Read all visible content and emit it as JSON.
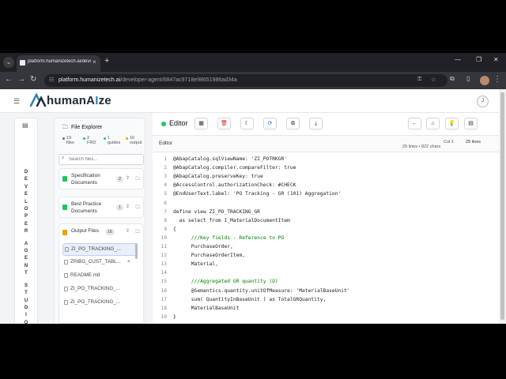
{
  "browser": {
    "tab_title": "platform.humanizetech.ai/deve",
    "tab_close": "×",
    "new_tab": "+",
    "url_host": "platform.humanizetech.ai",
    "url_path": "/developer-agent/6847ac9718e98651986ad34a"
  },
  "app": {
    "brand_left": "humanA",
    "brand_ai": "I",
    "brand_right": "ze",
    "user_initial": "J",
    "rail_text": [
      "D",
      "E",
      "V",
      "E",
      "L",
      "O",
      "P",
      "E",
      "R",
      "",
      "A",
      "G",
      "E",
      "N",
      "T",
      "",
      "S",
      "T",
      "U",
      "D",
      "I",
      "O"
    ]
  },
  "file_explorer": {
    "title": "File Explorer",
    "stats": [
      {
        "num": "19",
        "label": "files",
        "color": "#6b7280"
      },
      {
        "num": "2",
        "label": "FRD",
        "color": "#22c55e"
      },
      {
        "num": "1",
        "label": "guides",
        "color": "#22c55e"
      },
      {
        "num": "16",
        "label": "output",
        "color": "#f59e0b"
      }
    ],
    "search_placeholder": "Search files...",
    "sections": [
      {
        "label": "Specification Documents",
        "count": "2",
        "color": "#22c55e"
      },
      {
        "label": "Best Practice Documents",
        "count": "1",
        "color": "#22c55e"
      },
      {
        "label": "Output Files",
        "count": "16",
        "color": "#f59e0b"
      }
    ],
    "files": [
      {
        "name": "ZI_PO_TRACKING_...",
        "selected": true
      },
      {
        "name": "ZRIBG_CUST_TABL...",
        "close": "×"
      },
      {
        "name": "README.md"
      },
      {
        "name": "ZI_PO_TRACKING_..."
      },
      {
        "name": "ZI_PO_TRACKING_..."
      }
    ]
  },
  "editor": {
    "title": "Editor",
    "label": "Editor",
    "meta_lines": "29 lines • 822 chars",
    "meta_col": "Col 1",
    "meta_total": "29 lines",
    "code": [
      {
        "n": "1",
        "t": "@AbapCatalog.sqlViewName: 'ZI_POTRKGR'"
      },
      {
        "n": "2",
        "t": "@AbapCatalog.compiler.compareFilter: true"
      },
      {
        "n": "3",
        "t": "@AbapCatalog.preserveKey: true"
      },
      {
        "n": "4",
        "t": "@AccessControl.authorizationCheck: #CHECK"
      },
      {
        "n": "5",
        "t": "@EndUserText.label: 'PO Tracking - GR (101) Aggregation'"
      },
      {
        "n": "6",
        "t": ""
      },
      {
        "n": "7",
        "t": "define view ZI_PO_TRACKING_GR"
      },
      {
        "n": "8",
        "t": "  as select from I_MaterialDocumentItem"
      },
      {
        "n": "9",
        "t": "{"
      },
      {
        "n": "10",
        "t": "      ///Key fields - Reference to PO"
      },
      {
        "n": "11",
        "t": "      PurchaseOrder,"
      },
      {
        "n": "12",
        "t": "      PurchaseOrderItem,"
      },
      {
        "n": "13",
        "t": "      Material,"
      },
      {
        "n": "14",
        "t": ""
      },
      {
        "n": "15",
        "t": "      ///Aggregated GR quantity (O)"
      },
      {
        "n": "16",
        "t": "      @Semantics.quantity.unitOfMeasure: 'MaterialBaseUnit'"
      },
      {
        "n": "17",
        "t": "      sum( QuantityInBaseUnit ) as TotalGRQuantity,"
      },
      {
        "n": "18",
        "t": "      MaterialBaseUnit"
      },
      {
        "n": "19",
        "t": "}"
      }
    ]
  }
}
